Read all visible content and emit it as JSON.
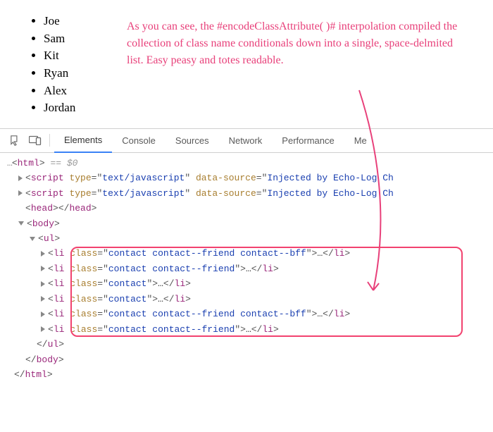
{
  "contacts": {
    "items": [
      {
        "name": "Joe"
      },
      {
        "name": "Sam"
      },
      {
        "name": "Kit"
      },
      {
        "name": "Ryan"
      },
      {
        "name": "Alex"
      },
      {
        "name": "Jordan"
      }
    ]
  },
  "annotation": {
    "text": "As you can see, the #encodeClassAttribute( )# interpolation compiled the collection of class name conditionals down into a single, space-delmited list. Easy peasy and totes readable."
  },
  "devtools": {
    "tabs": {
      "elements": "Elements",
      "console": "Console",
      "sources": "Sources",
      "network": "Network",
      "performance": "Performance",
      "memory_partial": "Me"
    },
    "dom": {
      "top_ellipsis": "…",
      "html_tag": "html",
      "equals_hint": " == $0",
      "script_tag": "script",
      "script_type_attr": "type",
      "script_type_val": "text/javascript",
      "script_source_attr": "data-source",
      "script_source_val": "Injected by Echo-Log Ch",
      "head_tag": "head",
      "body_tag": "body",
      "ul_tag": "ul",
      "li_tag": "li",
      "class_attr": "class",
      "li_ellipsis": "…",
      "lis": [
        {
          "class_val": "contact contact--friend contact--bff"
        },
        {
          "class_val": "contact contact--friend"
        },
        {
          "class_val": "contact"
        },
        {
          "class_val": "contact"
        },
        {
          "class_val": "contact contact--friend contact--bff"
        },
        {
          "class_val": "contact contact--friend"
        }
      ]
    }
  }
}
